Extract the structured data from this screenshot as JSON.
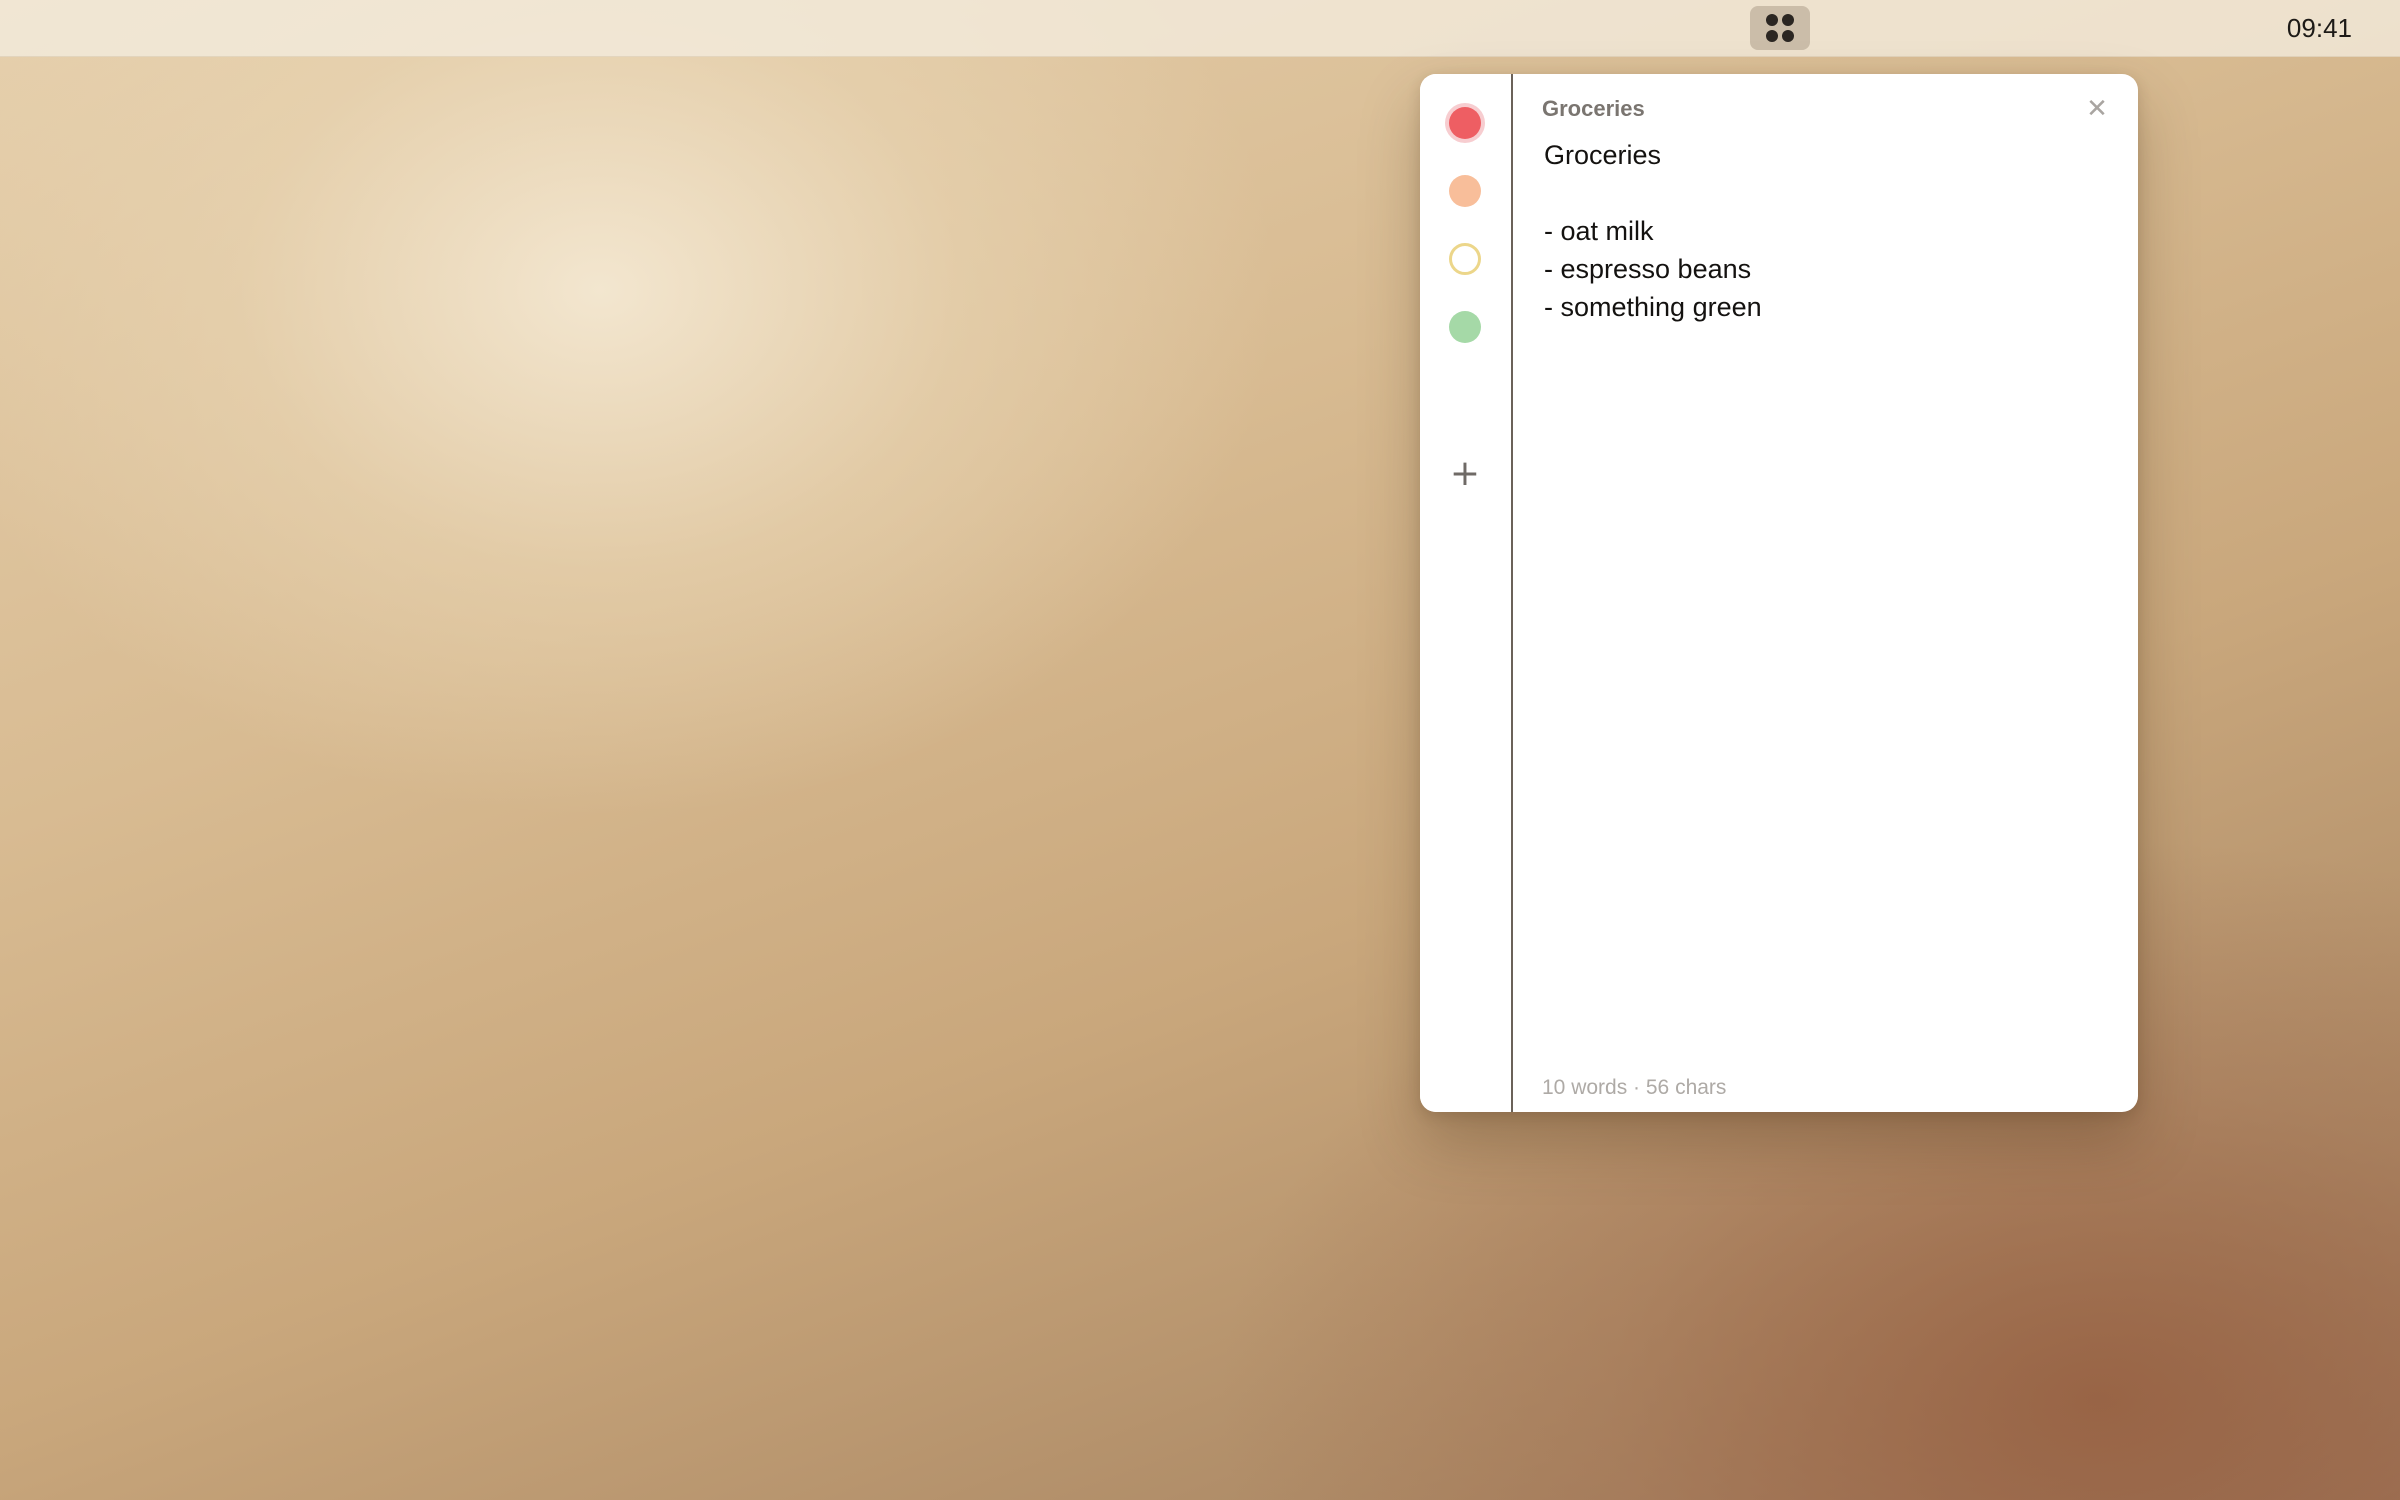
{
  "menubar": {
    "app_icon": "four-dot-grid-icon",
    "clock": "09:41"
  },
  "swatches": [
    {
      "name": "red",
      "color": "#ee5e63",
      "selected": true
    },
    {
      "name": "peach",
      "color": "#f8be9a",
      "selected": false
    },
    {
      "name": "yellow",
      "color": "#ecd68a",
      "selected": false
    },
    {
      "name": "green",
      "color": "#a5d9a7",
      "selected": false
    }
  ],
  "add_button": {
    "icon": "plus-icon",
    "label": "+"
  },
  "note": {
    "header_title": "Groceries",
    "close_icon": "close-icon",
    "close_label": "✕",
    "body": "Groceries\n\n- oat milk\n- espresso beans\n- something green",
    "stats": "10 words · 56 chars"
  }
}
